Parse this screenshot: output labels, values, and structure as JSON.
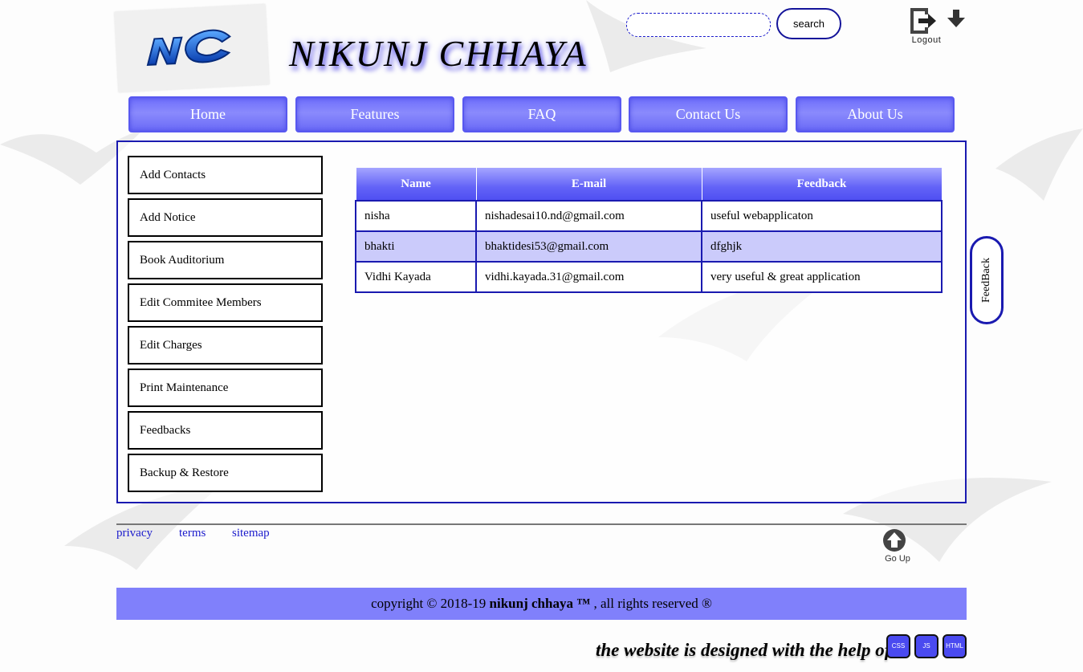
{
  "header": {
    "title": "NIKUNJ CHHAYA",
    "logo_text": "NC",
    "search_placeholder": "",
    "search_label": "search",
    "logout_label": "Logout"
  },
  "nav": [
    "Home",
    "Features",
    "FAQ",
    "Contact Us",
    "About Us"
  ],
  "sidebar": [
    "Add Contacts",
    "Add Notice",
    "Book Auditorium",
    "Edit Commitee Members",
    "Edit Charges",
    "Print Maintenance",
    "Feedbacks",
    "Backup & Restore"
  ],
  "table": {
    "headers": [
      "Name",
      "E-mail",
      "Feedback"
    ],
    "rows": [
      [
        "nisha",
        "nishadesai10.nd@gmail.com",
        "useful webapplicaton"
      ],
      [
        "bhakti",
        "bhaktidesi53@gmail.com",
        "dfghjk"
      ],
      [
        "Vidhi Kayada",
        "vidhi.kayada.31@gmail.com",
        "very useful & great application"
      ]
    ]
  },
  "feedback_tab": "FeedBack",
  "footer": {
    "links": [
      "privacy",
      "terms",
      "sitemap"
    ],
    "goup_label": "Go Up",
    "copyright_prefix": "copyright © 2018-19 ",
    "copyright_brand": "nikunj chhaya ™",
    "copyright_suffix": " , all rights reserved ®",
    "designed_text": "the website is designed with the help of",
    "tech_badges": [
      "CSS",
      "JS",
      "HTML"
    ]
  },
  "colors": {
    "nav_blue": "#6e6efb",
    "border_blue": "#1a1ab0",
    "row_highlight": "#cbcbfb",
    "footer_band": "#8080fb"
  }
}
